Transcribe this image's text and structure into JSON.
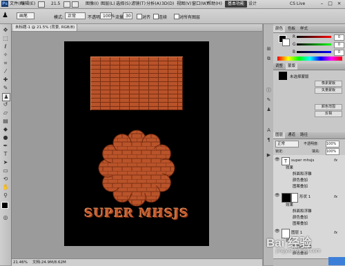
{
  "menubar": {
    "app_icon": "Ps",
    "menus": [
      "文件(F)",
      "编辑(E)",
      "图像(I)",
      "图层(L)",
      "选择(S)",
      "滤镜(T)",
      "分析(A)",
      "3D(D)",
      "视图(V)",
      "窗口(W)",
      "帮助(H)"
    ],
    "zoom": "21.5",
    "workspace_active": "基本功能",
    "workspace_other": "设计",
    "cs_live": "CS Live"
  },
  "options": {
    "brush_size": "画笔",
    "mode_label": "模式:",
    "mode_value": "正常",
    "opacity_label": "不透明度:",
    "opacity_value": "100%",
    "flow_label": "流量:",
    "flow_value": "30",
    "sample_label": "对齐",
    "aligned_label": "连续",
    "sample_all_label": "对所有图层"
  },
  "document": {
    "tab_title": "未标题-1 @ 21.5% (背景, RGB/8)",
    "super_text": "SUPER MHSJS",
    "zoom_status": "21.46%",
    "doc_status": "文档:24.9M/8.62M"
  },
  "color_panel": {
    "tabs": [
      "颜色",
      "色板",
      "样式"
    ],
    "channels": [
      "R",
      "G",
      "B"
    ],
    "values": [
      "0",
      "0",
      "0"
    ]
  },
  "adjust_panel": {
    "tabs": [
      "调整",
      "蒙版"
    ],
    "title": "未选择蒙版",
    "buttons": [
      "像素蒙版",
      "矢量蒙版",
      "颜色范围",
      "反相"
    ]
  },
  "layers_panel": {
    "tabs": [
      "图层",
      "通道",
      "路径"
    ],
    "blend_mode": "正常",
    "opacity_label": "不透明度:",
    "opacity_value": "100%",
    "lock_label": "锁定:",
    "fill_label": "填充:",
    "fill_value": "100%",
    "layers": [
      {
        "name": "super mhsjs",
        "kind": "text"
      },
      {
        "name": "效果",
        "kind": "fx"
      },
      {
        "name": "斜面和浮雕",
        "kind": "effect"
      },
      {
        "name": "颜色叠加",
        "kind": "effect"
      },
      {
        "name": "图案叠加",
        "kind": "effect"
      },
      {
        "name": "形状 1",
        "kind": "shape"
      },
      {
        "name": "效果",
        "kind": "fx"
      },
      {
        "name": "斜面和浮雕",
        "kind": "effect"
      },
      {
        "name": "颜色叠加",
        "kind": "effect"
      },
      {
        "name": "图案叠加",
        "kind": "effect"
      },
      {
        "name": "图层 1",
        "kind": "layer"
      },
      {
        "name": "效果",
        "kind": "fx"
      },
      {
        "name": "斜面和浮雕",
        "kind": "effect"
      },
      {
        "name": "颜色叠加",
        "kind": "effect"
      },
      {
        "name": "图案叠加",
        "kind": "effect"
      }
    ]
  },
  "watermark": "Bai 经验",
  "watermark_url": "jingyan.baidu.com",
  "colors": {
    "brick": "#b9532a",
    "canvas": "#000000",
    "ui": "#c8c8c8"
  }
}
